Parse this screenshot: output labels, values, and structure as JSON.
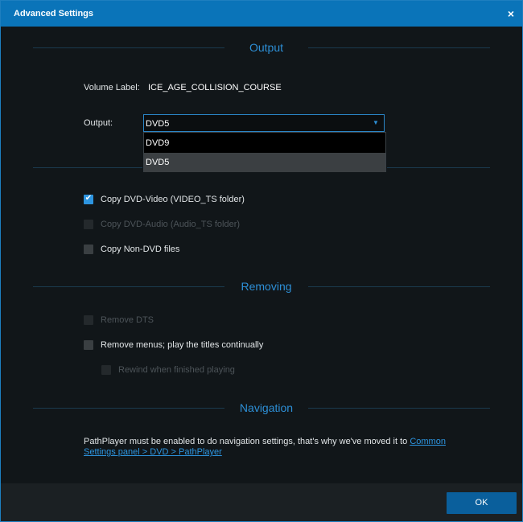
{
  "window": {
    "title": "Advanced Settings",
    "close_glyph": "×"
  },
  "sections": {
    "output": "Output",
    "removing": "Removing",
    "navigation": "Navigation"
  },
  "output": {
    "volume_label_caption": "Volume Label:",
    "volume_label_value": "ICE_AGE_COLLISION_COURSE",
    "output_caption": "Output:",
    "output_selected": "DVD5",
    "output_options": [
      "DVD9",
      "DVD5"
    ],
    "copy_dvd_video": {
      "label": "Copy DVD-Video (VIDEO_TS folder)",
      "checked": true,
      "enabled": true
    },
    "copy_dvd_audio": {
      "label": "Copy DVD-Audio (Audio_TS folder)",
      "checked": false,
      "enabled": false
    },
    "copy_non_dvd": {
      "label": "Copy Non-DVD files",
      "checked": false,
      "enabled": true
    }
  },
  "removing": {
    "remove_dts": {
      "label": "Remove DTS",
      "checked": false,
      "enabled": false
    },
    "remove_menus": {
      "label": "Remove menus; play the titles continually",
      "checked": false,
      "enabled": true
    },
    "rewind": {
      "label": "Rewind when finished playing",
      "checked": false,
      "enabled": false
    }
  },
  "navigation": {
    "info_text": "PathPlayer must be enabled to do navigation settings, that's why we've moved it to ",
    "link_text": "Common Settings panel > DVD > PathPlayer"
  },
  "footer": {
    "ok_label": "OK"
  },
  "colors": {
    "accent": "#0a74b9",
    "section_text": "#2d8fd6",
    "checkbox_checked": "#2d95e0",
    "ok_button": "#0a5f9c"
  }
}
